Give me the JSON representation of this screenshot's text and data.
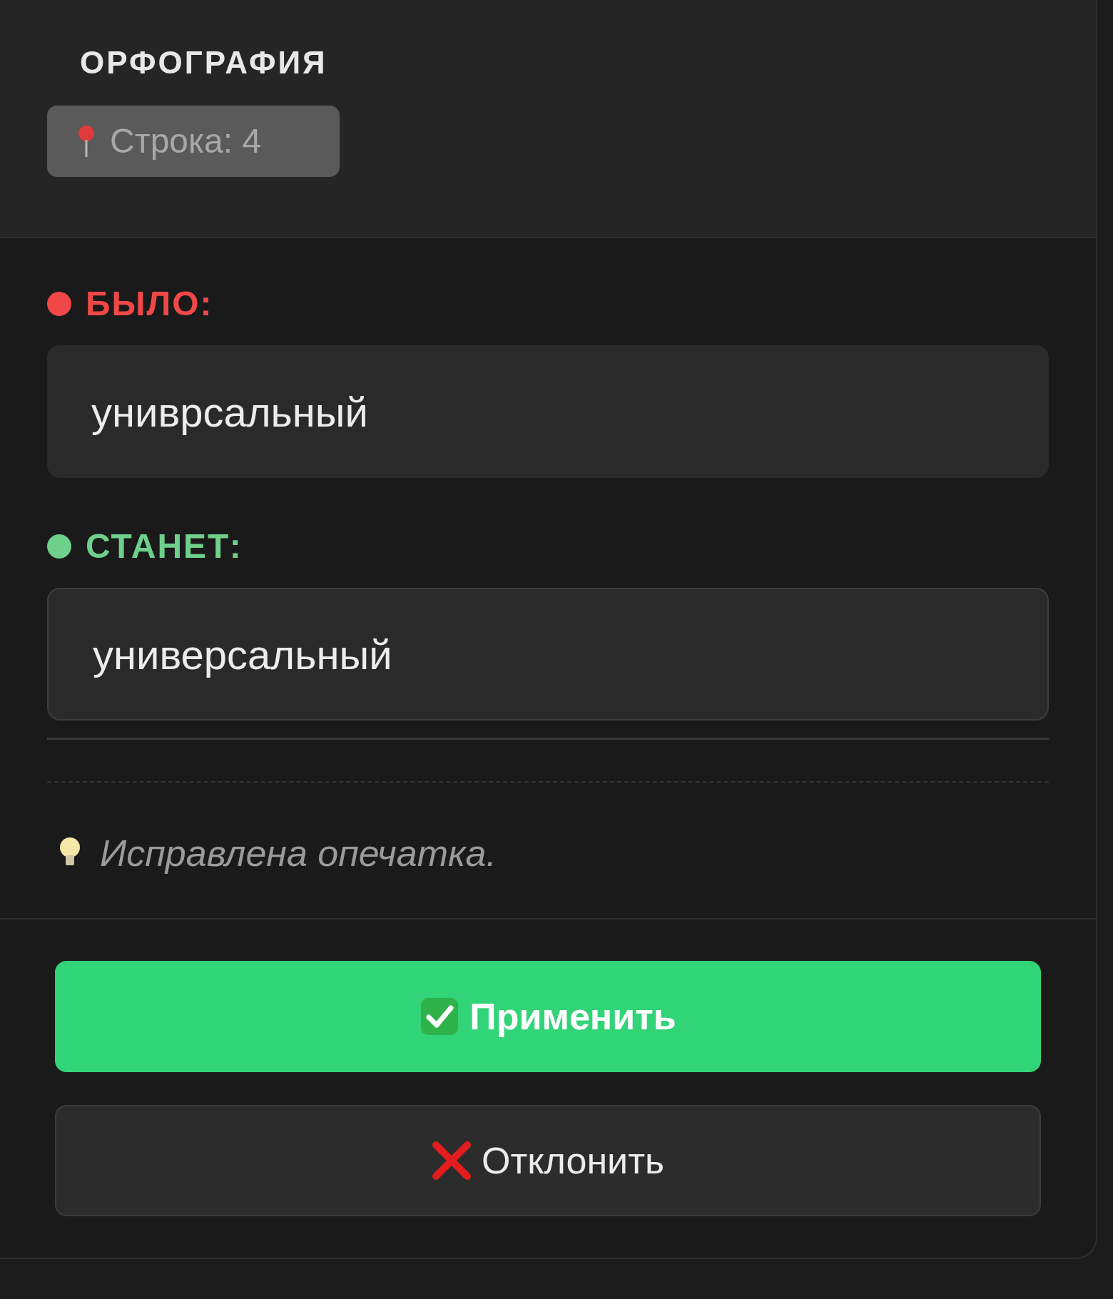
{
  "title": "ОРФОГРАФИЯ",
  "badge": "Строка: 4",
  "fields": [
    {
      "label": "БЫЛО:",
      "value": "униврсальный",
      "color": "#f04848",
      "kind": "before"
    },
    {
      "label": "СТАНЕТ:",
      "value": "универсальный",
      "color": "#6fd08c",
      "kind": "after"
    }
  ],
  "hint": "Исправлена опечатка.",
  "buttons": [
    {
      "label": "Применить",
      "kind": "apply"
    },
    {
      "label": "Отклонить",
      "kind": "reject"
    }
  ]
}
